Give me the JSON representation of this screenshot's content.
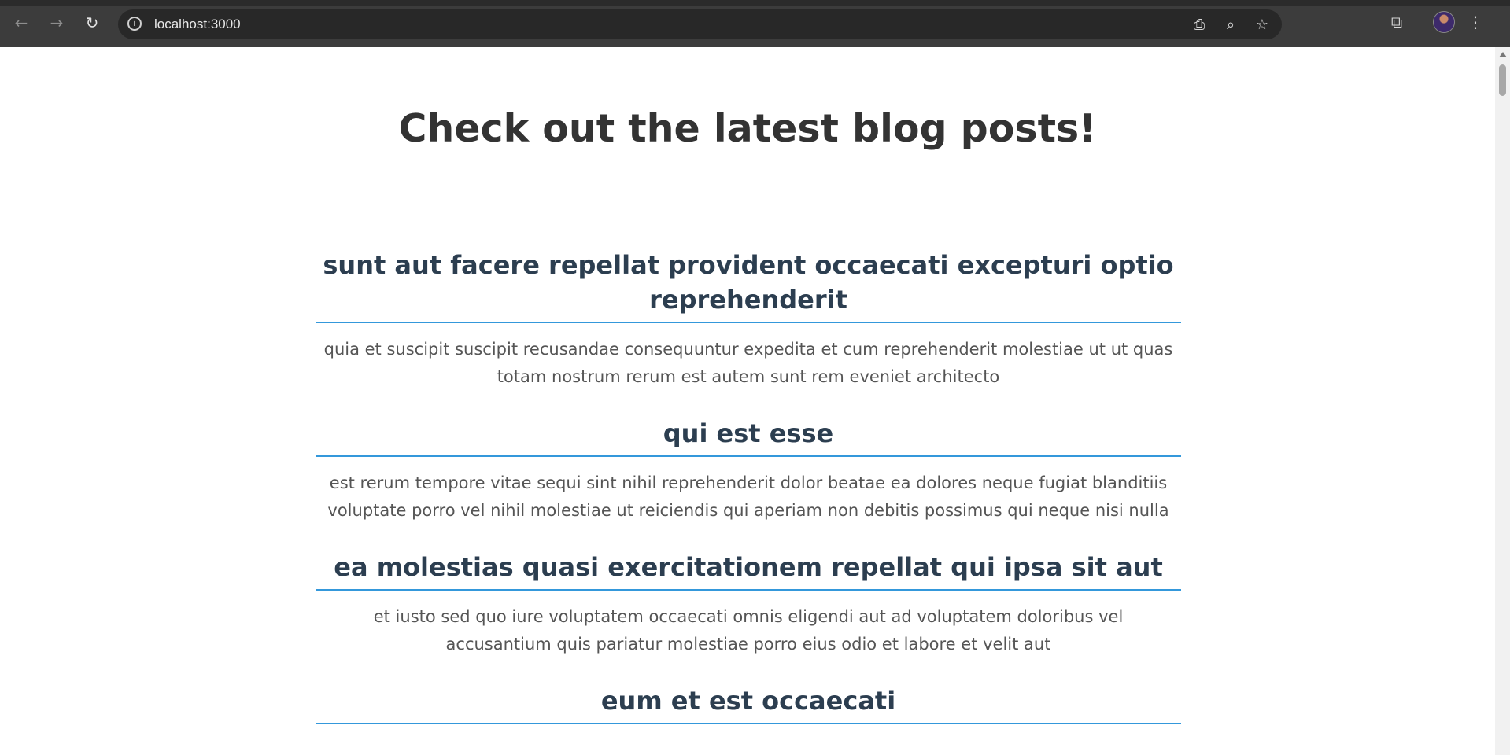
{
  "browser": {
    "url": "localhost:3000",
    "icons": {
      "back": "arrow-left-icon",
      "forward": "arrow-right-icon",
      "reload": "reload-icon",
      "site_info": "info-icon",
      "install": "install-app-icon",
      "zoom": "zoom-icon",
      "bookmark": "star-icon",
      "extensions": "puzzle-icon",
      "profile": "avatar",
      "menu": "kebab-menu-icon"
    }
  },
  "page": {
    "heading": "Check out the latest blog posts!",
    "posts": [
      {
        "title": "sunt aut facere repellat provident occaecati excepturi optio reprehenderit",
        "body": "quia et suscipit suscipit recusandae consequuntur expedita et cum reprehenderit molestiae ut ut quas totam nostrum rerum est autem sunt rem eveniet architecto"
      },
      {
        "title": "qui est esse",
        "body": "est rerum tempore vitae sequi sint nihil reprehenderit dolor beatae ea dolores neque fugiat blanditiis voluptate porro vel nihil molestiae ut reiciendis qui aperiam non debitis possimus qui neque nisi nulla"
      },
      {
        "title": "ea molestias quasi exercitationem repellat qui ipsa sit aut",
        "body": "et iusto sed quo iure voluptatem occaecati omnis eligendi aut ad voluptatem doloribus vel accusantium quis pariatur molestiae porro eius odio et labore et velit aut"
      },
      {
        "title": "eum et est occaecati",
        "body": ""
      }
    ]
  },
  "colors": {
    "title": "#2c3e50",
    "underline": "#3498db",
    "body_text": "#555555",
    "heading": "#333333"
  }
}
